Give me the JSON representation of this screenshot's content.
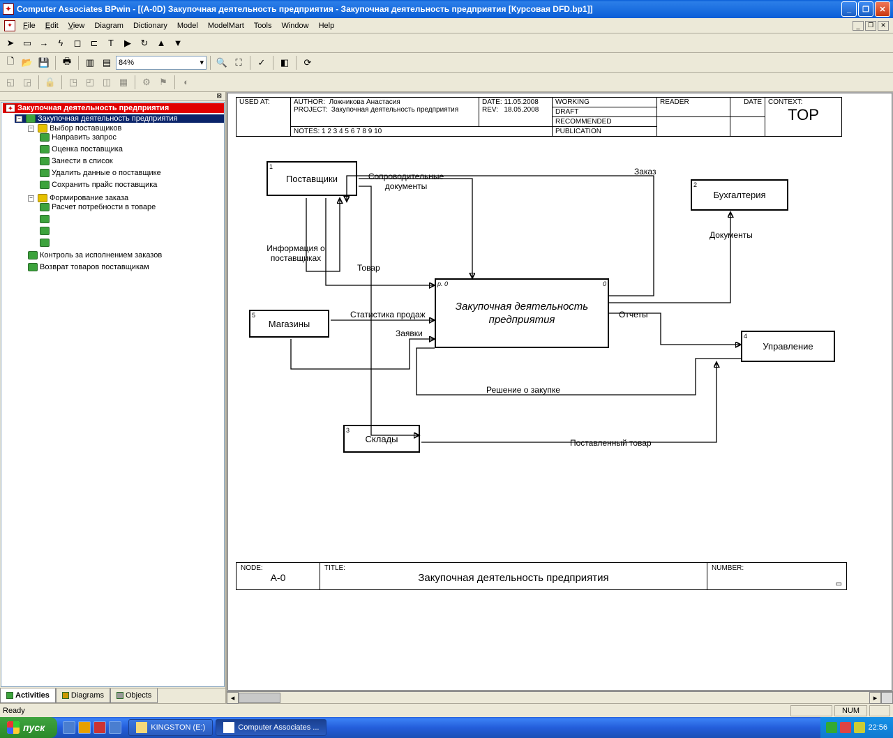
{
  "titlebar": {
    "text": "Computer Associates BPwin - [(A-0D) Закупочная деятельность  предприятия - Закупочная деятельность предприятия  [Курсовая DFD.bp1]]"
  },
  "menu": {
    "file": "File",
    "edit": "Edit",
    "view": "View",
    "diagram": "Diagram",
    "dictionary": "Dictionary",
    "model": "Model",
    "modelmart": "ModelMart",
    "tools": "Tools",
    "window": "Window",
    "help": "Help"
  },
  "toolbar": {
    "zoom": "84%"
  },
  "tree": {
    "root": "Закупочная деятельность предприятия",
    "n1": "Закупочная деятельность  предприятия",
    "n2": "Выбор поставщиков",
    "n2_1": "Направить запрос",
    "n2_2": "Оценка поставщика",
    "n2_3": "Занести в список",
    "n2_4": "Удалить данные о поставщике",
    "n2_5": "Сохранить прайс поставщика",
    "n3": "Формирование заказа",
    "n3_1": "Расчет потребности в товаре",
    "n4": "Контроль за исполнением заказов",
    "n5": "Возврат товаров поставщикам"
  },
  "tabs": {
    "activities": "Activities",
    "diagrams": "Diagrams",
    "objects": "Objects"
  },
  "header": {
    "used_at": "USED AT:",
    "author_lbl": "AUTHOR:",
    "author": "Ложникова Анастасия",
    "project_lbl": "PROJECT:",
    "project": "Закупочная деятельность предприятия",
    "notes": "NOTES:  1  2  3  4  5  6  7  8  9  10",
    "date_lbl": "DATE:",
    "date": "11.05.2008",
    "rev_lbl": "REV:",
    "rev": "18.05.2008",
    "working": "WORKING",
    "draft": "DRAFT",
    "recommended": "RECOMMENDED",
    "publication": "PUBLICATION",
    "reader": "READER",
    "header_date": "DATE",
    "context_lbl": "CONTEXT:",
    "context": "TOP"
  },
  "diagram": {
    "box_suppliers": "Поставщики",
    "box_suppliers_n": "1",
    "box_shops": "Магазины",
    "box_shops_n": "5",
    "box_warehouses": "Склады",
    "box_warehouses_n": "3",
    "box_accounting": "Бухгалтерия",
    "box_accounting_n": "2",
    "box_management": "Управление",
    "box_management_n": "4",
    "box_main": "Закупочная деятельность предприятия",
    "box_main_p": "p. 0",
    "box_main_0": "0",
    "lbl_docs": "Сопроводительные документы",
    "lbl_order": "Заказ",
    "lbl_supplier_info": "Информация о поставщиках",
    "lbl_goods": "Товар",
    "lbl_stats": "Статистика продаж",
    "lbl_requests": "Заявки",
    "lbl_decision": "Решение о закупке",
    "lbl_delivered": "Поставленный товар",
    "lbl_reports": "Отчеты",
    "lbl_documents": "Документы"
  },
  "footer": {
    "node_lbl": "NODE:",
    "node": "A-0",
    "title_lbl": "TITLE:",
    "title": "Закупочная деятельность  предприятия",
    "number_lbl": "NUMBER:"
  },
  "status": {
    "ready": "Ready",
    "num": "NUM"
  },
  "taskbar": {
    "start": "пуск",
    "task1": "KINGSTON (E:)",
    "task2": "Computer Associates ...",
    "clock": "22:56"
  }
}
